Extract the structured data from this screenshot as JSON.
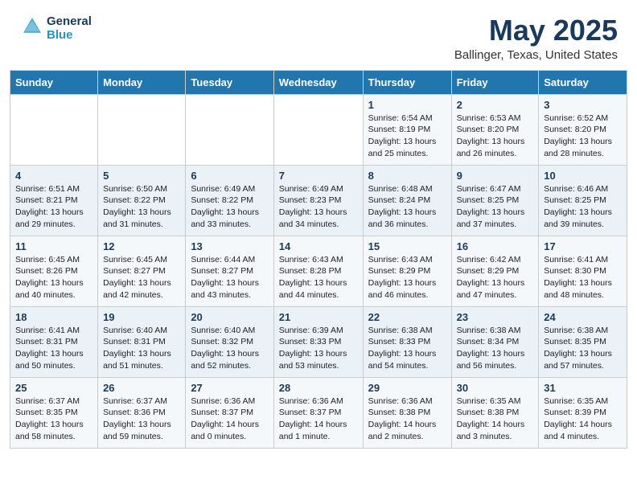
{
  "header": {
    "logo_line1": "General",
    "logo_line2": "Blue",
    "month_title": "May 2025",
    "location": "Ballinger, Texas, United States"
  },
  "weekdays": [
    "Sunday",
    "Monday",
    "Tuesday",
    "Wednesday",
    "Thursday",
    "Friday",
    "Saturday"
  ],
  "weeks": [
    [
      {
        "day": "",
        "detail": ""
      },
      {
        "day": "",
        "detail": ""
      },
      {
        "day": "",
        "detail": ""
      },
      {
        "day": "",
        "detail": ""
      },
      {
        "day": "1",
        "detail": "Sunrise: 6:54 AM\nSunset: 8:19 PM\nDaylight: 13 hours\nand 25 minutes."
      },
      {
        "day": "2",
        "detail": "Sunrise: 6:53 AM\nSunset: 8:20 PM\nDaylight: 13 hours\nand 26 minutes."
      },
      {
        "day": "3",
        "detail": "Sunrise: 6:52 AM\nSunset: 8:20 PM\nDaylight: 13 hours\nand 28 minutes."
      }
    ],
    [
      {
        "day": "4",
        "detail": "Sunrise: 6:51 AM\nSunset: 8:21 PM\nDaylight: 13 hours\nand 29 minutes."
      },
      {
        "day": "5",
        "detail": "Sunrise: 6:50 AM\nSunset: 8:22 PM\nDaylight: 13 hours\nand 31 minutes."
      },
      {
        "day": "6",
        "detail": "Sunrise: 6:49 AM\nSunset: 8:22 PM\nDaylight: 13 hours\nand 33 minutes."
      },
      {
        "day": "7",
        "detail": "Sunrise: 6:49 AM\nSunset: 8:23 PM\nDaylight: 13 hours\nand 34 minutes."
      },
      {
        "day": "8",
        "detail": "Sunrise: 6:48 AM\nSunset: 8:24 PM\nDaylight: 13 hours\nand 36 minutes."
      },
      {
        "day": "9",
        "detail": "Sunrise: 6:47 AM\nSunset: 8:25 PM\nDaylight: 13 hours\nand 37 minutes."
      },
      {
        "day": "10",
        "detail": "Sunrise: 6:46 AM\nSunset: 8:25 PM\nDaylight: 13 hours\nand 39 minutes."
      }
    ],
    [
      {
        "day": "11",
        "detail": "Sunrise: 6:45 AM\nSunset: 8:26 PM\nDaylight: 13 hours\nand 40 minutes."
      },
      {
        "day": "12",
        "detail": "Sunrise: 6:45 AM\nSunset: 8:27 PM\nDaylight: 13 hours\nand 42 minutes."
      },
      {
        "day": "13",
        "detail": "Sunrise: 6:44 AM\nSunset: 8:27 PM\nDaylight: 13 hours\nand 43 minutes."
      },
      {
        "day": "14",
        "detail": "Sunrise: 6:43 AM\nSunset: 8:28 PM\nDaylight: 13 hours\nand 44 minutes."
      },
      {
        "day": "15",
        "detail": "Sunrise: 6:43 AM\nSunset: 8:29 PM\nDaylight: 13 hours\nand 46 minutes."
      },
      {
        "day": "16",
        "detail": "Sunrise: 6:42 AM\nSunset: 8:29 PM\nDaylight: 13 hours\nand 47 minutes."
      },
      {
        "day": "17",
        "detail": "Sunrise: 6:41 AM\nSunset: 8:30 PM\nDaylight: 13 hours\nand 48 minutes."
      }
    ],
    [
      {
        "day": "18",
        "detail": "Sunrise: 6:41 AM\nSunset: 8:31 PM\nDaylight: 13 hours\nand 50 minutes."
      },
      {
        "day": "19",
        "detail": "Sunrise: 6:40 AM\nSunset: 8:31 PM\nDaylight: 13 hours\nand 51 minutes."
      },
      {
        "day": "20",
        "detail": "Sunrise: 6:40 AM\nSunset: 8:32 PM\nDaylight: 13 hours\nand 52 minutes."
      },
      {
        "day": "21",
        "detail": "Sunrise: 6:39 AM\nSunset: 8:33 PM\nDaylight: 13 hours\nand 53 minutes."
      },
      {
        "day": "22",
        "detail": "Sunrise: 6:38 AM\nSunset: 8:33 PM\nDaylight: 13 hours\nand 54 minutes."
      },
      {
        "day": "23",
        "detail": "Sunrise: 6:38 AM\nSunset: 8:34 PM\nDaylight: 13 hours\nand 56 minutes."
      },
      {
        "day": "24",
        "detail": "Sunrise: 6:38 AM\nSunset: 8:35 PM\nDaylight: 13 hours\nand 57 minutes."
      }
    ],
    [
      {
        "day": "25",
        "detail": "Sunrise: 6:37 AM\nSunset: 8:35 PM\nDaylight: 13 hours\nand 58 minutes."
      },
      {
        "day": "26",
        "detail": "Sunrise: 6:37 AM\nSunset: 8:36 PM\nDaylight: 13 hours\nand 59 minutes."
      },
      {
        "day": "27",
        "detail": "Sunrise: 6:36 AM\nSunset: 8:37 PM\nDaylight: 14 hours\nand 0 minutes."
      },
      {
        "day": "28",
        "detail": "Sunrise: 6:36 AM\nSunset: 8:37 PM\nDaylight: 14 hours\nand 1 minute."
      },
      {
        "day": "29",
        "detail": "Sunrise: 6:36 AM\nSunset: 8:38 PM\nDaylight: 14 hours\nand 2 minutes."
      },
      {
        "day": "30",
        "detail": "Sunrise: 6:35 AM\nSunset: 8:38 PM\nDaylight: 14 hours\nand 3 minutes."
      },
      {
        "day": "31",
        "detail": "Sunrise: 6:35 AM\nSunset: 8:39 PM\nDaylight: 14 hours\nand 4 minutes."
      }
    ]
  ]
}
